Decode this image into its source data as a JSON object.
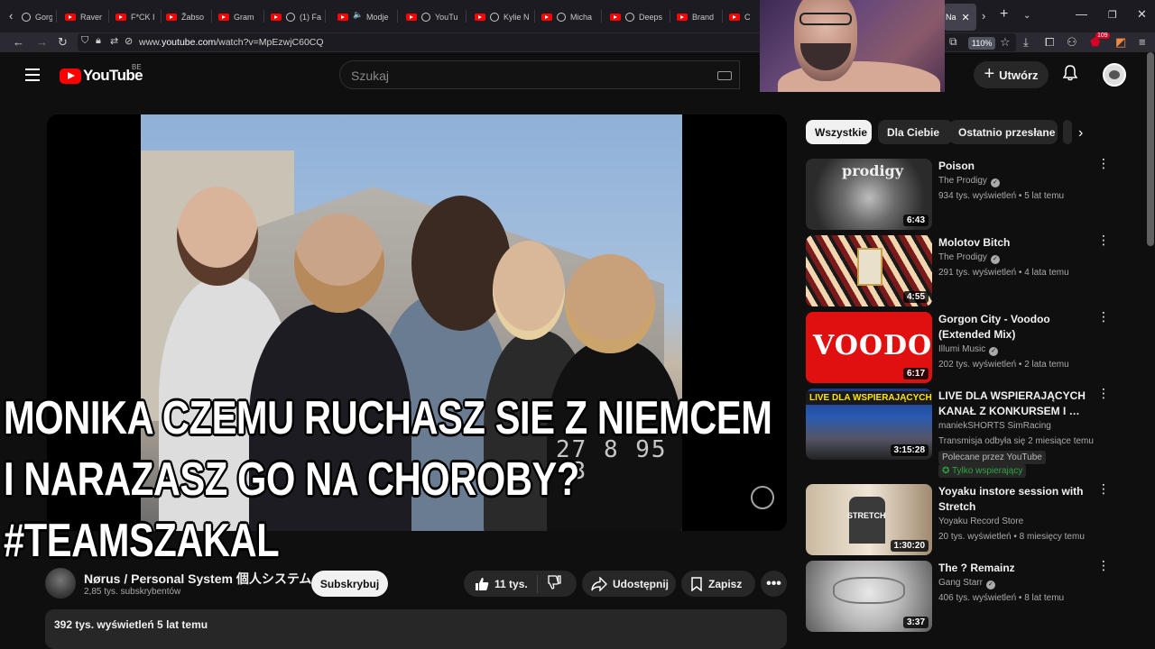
{
  "browser": {
    "tabs": [
      "Gorgo",
      "Raver",
      "F*CK I",
      "Žabso",
      "Gram",
      "(1) Fa",
      "Modje",
      "YouTu",
      "Kylie N",
      "Micha",
      "Deeps",
      "Brand",
      "C",
      "Na"
    ],
    "url_prefix": "www.",
    "url_domain": "youtube.com",
    "url_path": "/watch?v=MpEzwjC60CQ",
    "zoom": "110%",
    "ext_badge": "109"
  },
  "header": {
    "logo_text": "YouTube",
    "country": "BE",
    "search_placeholder": "Szukaj",
    "create_label": "Utwórz"
  },
  "video": {
    "timestamp_overlay": "27 8 95\n 3",
    "meme_line1": "MONIKA CZEMU RUCHASZ SIE Z NIEMCEM",
    "meme_line2": "I NARAZASZ GO NA CHOROBY?",
    "meme_line3": "#TEAMSZAKAL",
    "channel_name": "Nørus / Personal System 個人システム",
    "subscribers": "2,85 tys. subskrybentów",
    "subscribe_label": "Subskrybuj",
    "likes": "11 tys.",
    "share_label": "Udostępnij",
    "save_label": "Zapisz",
    "views_date": "392 tys. wyświetleń  5 lat temu"
  },
  "sidebar": {
    "chips": [
      "Wszystkie",
      "Dla Ciebie",
      "Ostatnio przesłane"
    ],
    "items": [
      {
        "title": "Poison",
        "channel": "The Prodigy",
        "meta": "934 tys. wyświetleń • 5 lat temu",
        "duration": "6:43",
        "thumb_text": "prodigy"
      },
      {
        "title": "Molotov Bitch",
        "channel": "The Prodigy",
        "meta": "291 tys. wyświetleń • 4 lata temu",
        "duration": "4:55"
      },
      {
        "title": "Gorgon City - Voodoo (Extended Mix)",
        "channel": "Illumi Music",
        "meta": "202 tys. wyświetleń • 2 lata temu",
        "duration": "6:17",
        "thumb_text": "VOODOO"
      },
      {
        "title": "LIVE DLA WSPIERAJĄCYCH KANAŁ Z KONKURSEM I …",
        "channel": "maniekSHORTS SimRacing",
        "meta": "Transmisja odbyła się 2 miesiące temu",
        "duration": "3:15:28",
        "tag": "Polecane przez YouTube",
        "tag2": "Tylko wspierający",
        "thumb_text": "LIVE DLA WSPIERAJĄCYCH"
      },
      {
        "title": "Yoyaku instore session with Stretch",
        "channel": "Yoyaku Record Store",
        "meta": "20 tys. wyświetleń • 8 miesięcy temu",
        "duration": "1:30:20",
        "thumb_text": "STRETCH"
      },
      {
        "title": "The ? Remainz",
        "channel": "Gang Starr",
        "meta": "406 tys. wyświetleń • 8 lat temu",
        "duration": "3:37"
      }
    ]
  },
  "colors": {
    "brand_red": "#ff0000",
    "background": "#0f0f0f",
    "chip_bg": "#272727",
    "verified_green": "#2ba640"
  }
}
